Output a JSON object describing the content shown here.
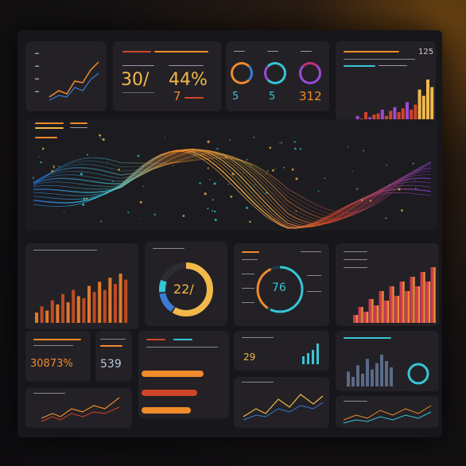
{
  "metrics": {
    "card2_value_a": "30/",
    "card2_value_b": "44%",
    "card2_value_c": "7",
    "card3_value_a": "5",
    "card3_value_b": "5",
    "card3_value_c": "312",
    "card4_value": "125",
    "donut_value": "22/",
    "ring_value": "76",
    "big_percent": "30873%",
    "small_value": "539",
    "mini_value": "29"
  },
  "colors": {
    "orange": "#f08a2a",
    "amber": "#f2b84a",
    "cyan": "#36c5d6",
    "blue": "#3a7bd5",
    "purple": "#9a4ad8",
    "magenta": "#c0307a",
    "red": "#d0452a"
  },
  "chart_data": [
    {
      "type": "bar",
      "series": [
        {
          "values": [
            4,
            6,
            5,
            9,
            7,
            12,
            8,
            10,
            11,
            14,
            9,
            13,
            16,
            12,
            15,
            20,
            14,
            18,
            30,
            25,
            38,
            32
          ]
        }
      ]
    },
    {
      "type": "bar",
      "series": [
        {
          "values": [
            5,
            8,
            6,
            11,
            9,
            14,
            10,
            16,
            13,
            12,
            18,
            15,
            20,
            16,
            22,
            19,
            24,
            21
          ]
        }
      ]
    },
    {
      "type": "area",
      "series": [
        {
          "values": [
            10,
            20,
            14,
            30,
            22,
            40,
            28,
            46,
            34,
            52,
            40,
            58,
            46,
            64,
            52,
            70
          ]
        }
      ]
    },
    {
      "type": "bar",
      "series": [
        {
          "values": [
            14,
            9,
            20,
            12,
            26,
            16,
            22,
            30,
            24,
            18
          ]
        }
      ]
    }
  ],
  "icons": {
    "wave": "flowing-data-wave-icon",
    "donut": "donut-chart-icon",
    "rings": "progress-ring-icon"
  }
}
